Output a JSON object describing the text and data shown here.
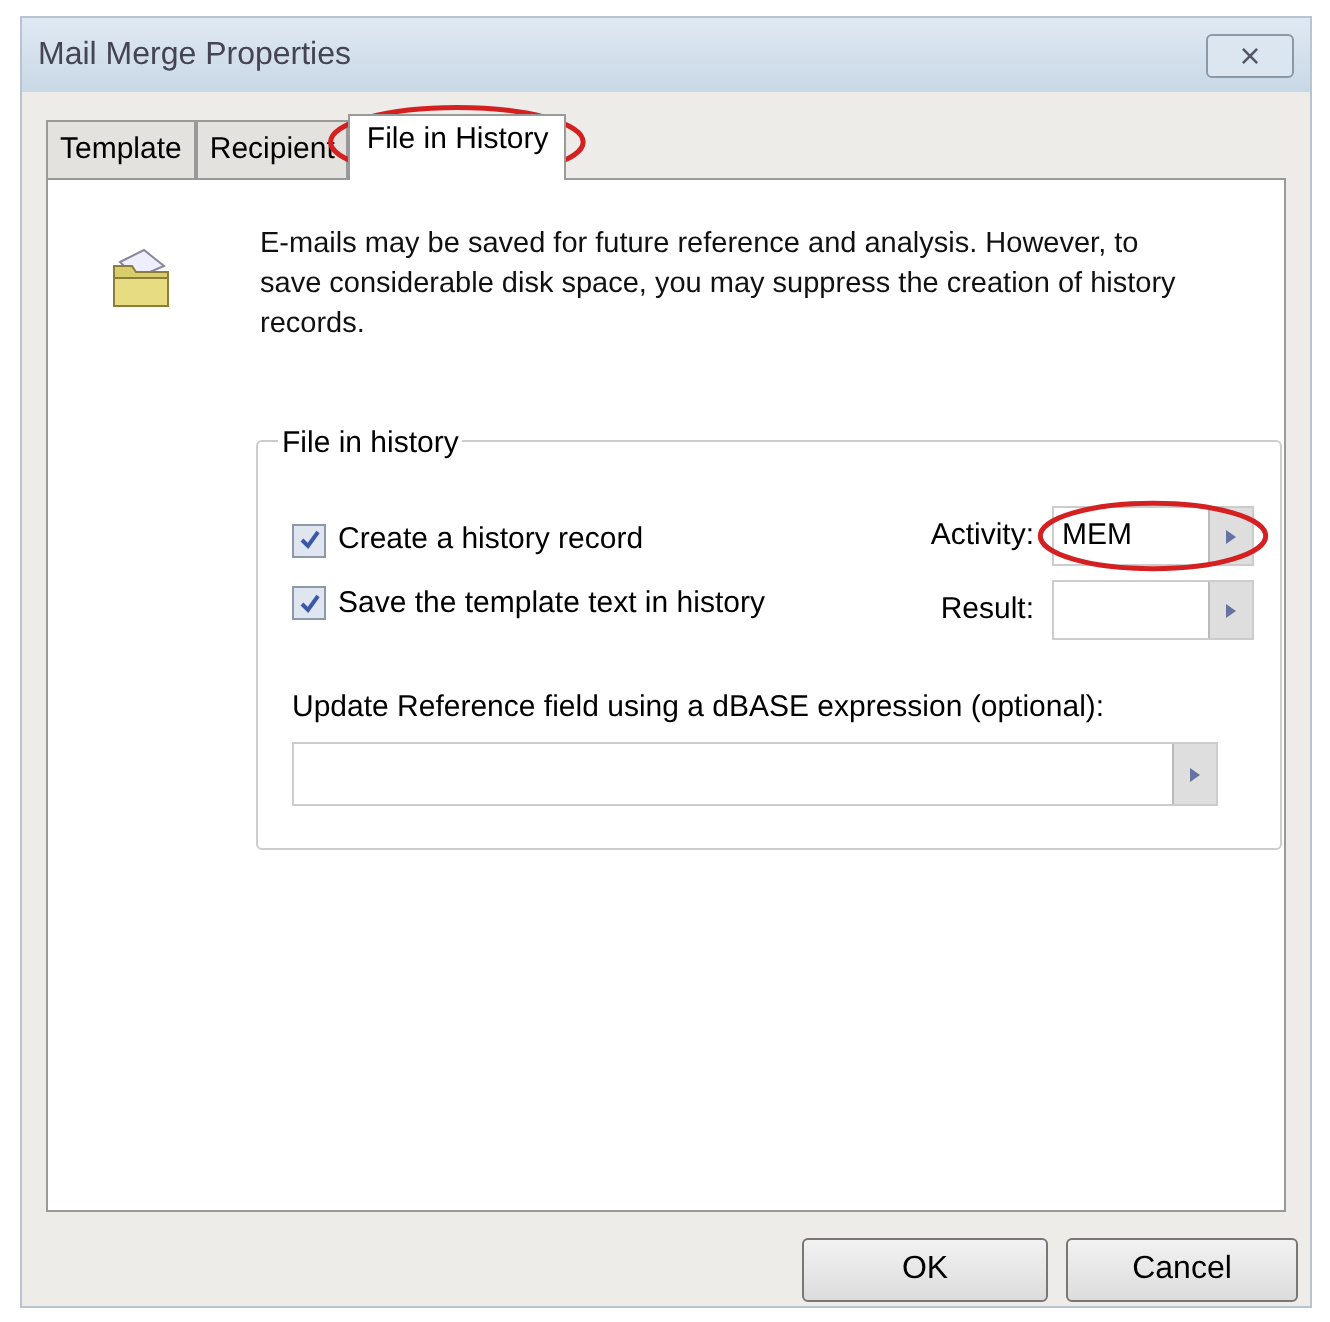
{
  "window": {
    "title": "Mail Merge Properties",
    "close": "×"
  },
  "tabs": [
    {
      "label": "Template",
      "selected": false,
      "circled": false
    },
    {
      "label": "Recipient",
      "selected": false,
      "circled": false
    },
    {
      "label": "File in History",
      "selected": true,
      "circled": true
    }
  ],
  "intro": "E-mails may be saved for future reference and analysis.  However, to save considerable disk space, you may suppress the creation of history records.",
  "group": {
    "title": "File in history",
    "checkboxes": [
      {
        "label": "Create a history record",
        "checked": true
      },
      {
        "label": "Save the template text in history",
        "checked": true
      }
    ],
    "fields": [
      {
        "label": "Activity:",
        "value": "MEM",
        "circled": true
      },
      {
        "label": "Result:",
        "circled": false
      }
    ],
    "expression": {
      "label": "Update Reference field using a dBASE expression (optional):"
    }
  },
  "buttons": [
    "OK",
    "Cancel"
  ]
}
